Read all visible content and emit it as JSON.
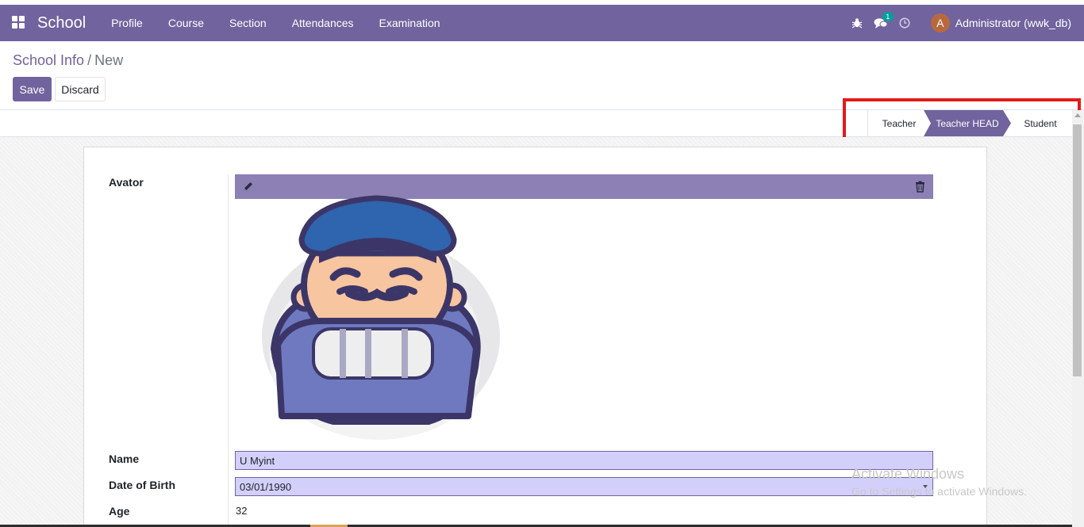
{
  "navbar": {
    "brand": "School",
    "menu": [
      "Profile",
      "Course",
      "Section",
      "Attendances",
      "Examination"
    ],
    "messages_badge": "1",
    "user_initial": "A",
    "user_name": "Administrator (wwk_db)"
  },
  "breadcrumb": {
    "parent": "School Info",
    "separator": "/",
    "current": "New"
  },
  "buttons": {
    "save": "Save",
    "discard": "Discard"
  },
  "statusbar": {
    "steps": [
      "Teacher",
      "Teacher HEAD",
      "Student"
    ],
    "active_step": "Teacher HEAD"
  },
  "form": {
    "avatar_label": "Avator",
    "name_label": "Name",
    "name_value": "U Myint",
    "dob_label": "Date of Birth",
    "dob_value": "03/01/1990",
    "age_label": "Age",
    "age_value": "32"
  },
  "watermark": {
    "title": "Activate Windows",
    "subtitle": "Go to Settings to activate Windows."
  },
  "colors": {
    "brand": "#71639e",
    "highlight": "#e41a1c",
    "input_bg": "#d2d0fb",
    "toolbar": "#8c80b5"
  },
  "icons": [
    "apps-icon",
    "bug-icon",
    "chat-icon",
    "clock-icon",
    "pencil-icon",
    "trash-icon"
  ]
}
